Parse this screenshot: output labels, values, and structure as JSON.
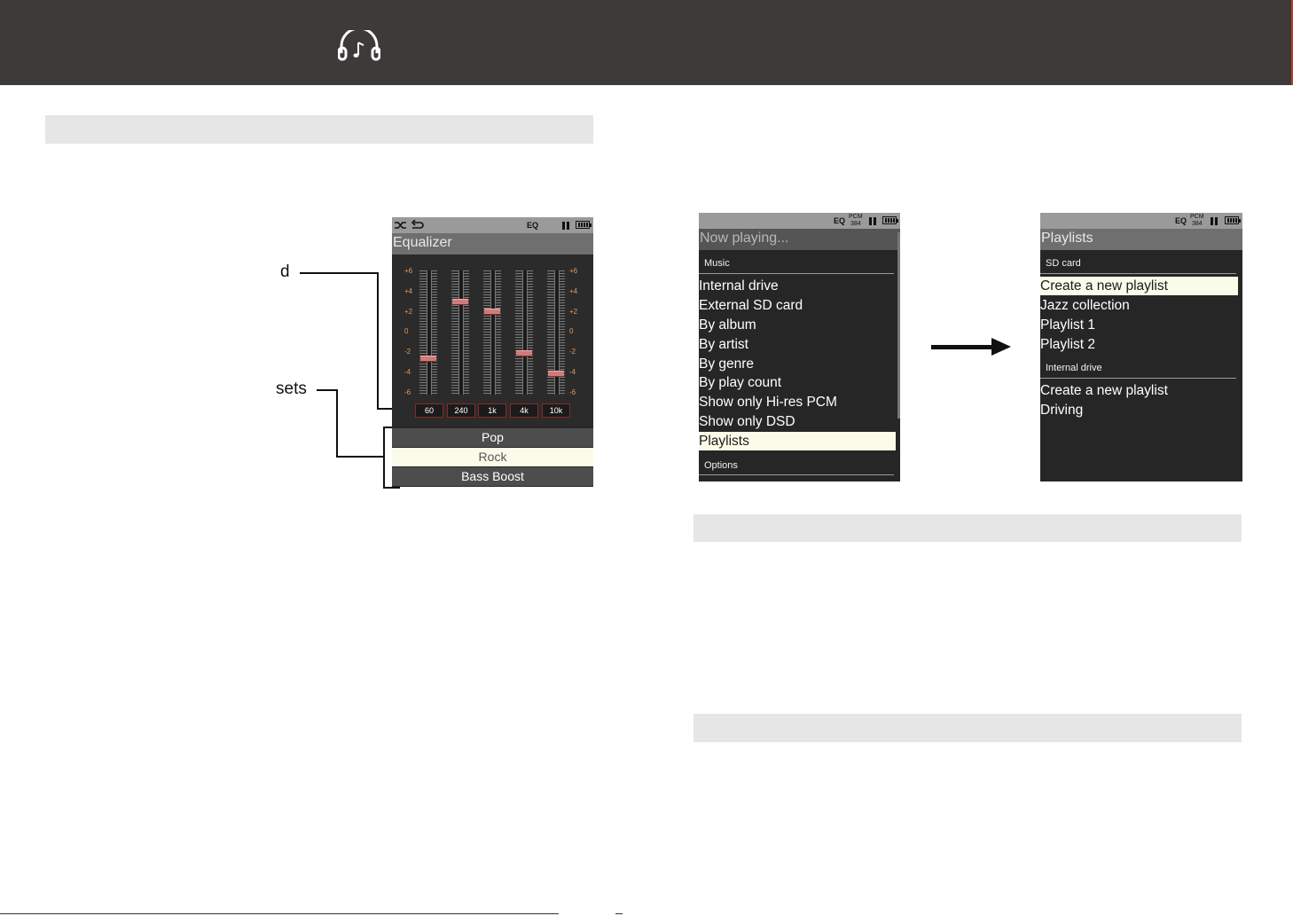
{
  "header": {
    "icon": "headphones-music-icon",
    "background": "#3e3a39",
    "accent_edge": "#c0392b"
  },
  "callouts": {
    "band_label": "d",
    "presets_label": "sets"
  },
  "equalizer_screen": {
    "status_icons": [
      "shuffle-icon",
      "repeat-icon",
      "pause-icon",
      "battery-icon"
    ],
    "status_eq": "EQ",
    "title": "Equalizer",
    "scale_labels": [
      "+6",
      "+4",
      "+2",
      "0",
      "-2",
      "-4",
      "-6"
    ],
    "bands": [
      {
        "label": "60",
        "level_db": -2.5
      },
      {
        "label": "240",
        "level_db": 3
      },
      {
        "label": "1k",
        "level_db": 2
      },
      {
        "label": "4k",
        "level_db": -2
      },
      {
        "label": "10k",
        "level_db": -4
      }
    ],
    "presets": [
      {
        "label": "Pop",
        "selected": false
      },
      {
        "label": "Rock",
        "selected": true
      },
      {
        "label": "Bass Boost",
        "selected": false
      }
    ]
  },
  "music_screen": {
    "status_eq": "EQ",
    "status_pcm_top": "PCM",
    "status_pcm_bottom": "384",
    "title": "Now playing...",
    "section_music": "Music",
    "items": [
      {
        "label": "Internal drive",
        "selected": false
      },
      {
        "label": "External SD card",
        "selected": false
      },
      {
        "label": "By album",
        "selected": false
      },
      {
        "label": "By artist",
        "selected": false
      },
      {
        "label": "By genre",
        "selected": false
      },
      {
        "label": "By play count",
        "selected": false
      },
      {
        "label": "Show only Hi-res PCM",
        "selected": false
      },
      {
        "label": "Show only DSD",
        "selected": false
      },
      {
        "label": "Playlists",
        "selected": true
      }
    ],
    "section_options": "Options"
  },
  "playlists_screen": {
    "status_eq": "EQ",
    "status_pcm_top": "PCM",
    "status_pcm_bottom": "384",
    "title": "Playlists",
    "section_sd": "SD card",
    "sd_items": [
      {
        "label": "Create a new playlist",
        "selected": true
      },
      {
        "label": "Jazz collection",
        "selected": false
      },
      {
        "label": "Playlist 1",
        "selected": false
      },
      {
        "label": "Playlist 2",
        "selected": false
      }
    ],
    "section_internal": "Internal drive",
    "internal_items": [
      {
        "label": "Create a new playlist",
        "selected": false
      },
      {
        "label": "Driving",
        "selected": false
      }
    ]
  },
  "flow_arrow": "arrow-right-icon"
}
